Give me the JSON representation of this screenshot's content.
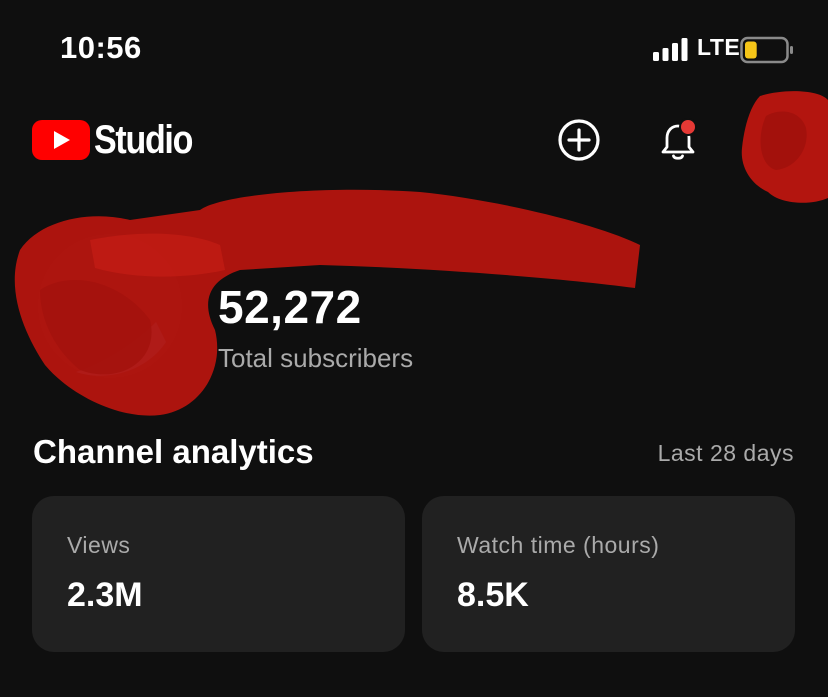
{
  "status_bar": {
    "time": "10:56",
    "network": "LTE",
    "battery_level": 0.3,
    "battery_color": "#f5c518"
  },
  "header": {
    "app_name": "Studio",
    "brand_color": "#ff0000",
    "actions": {
      "create_icon": "plus-circle-icon",
      "notifications_icon": "bell-icon",
      "notification_dot_color": "#e53935"
    }
  },
  "channel": {
    "subscriber_count": "52,272",
    "subscriber_label": "Total subscribers"
  },
  "analytics": {
    "title": "Channel analytics",
    "period": "Last 28 days",
    "cards": [
      {
        "label": "Views",
        "value": "2.3M"
      },
      {
        "label": "Watch time (hours)",
        "value": "8.5K"
      }
    ]
  }
}
